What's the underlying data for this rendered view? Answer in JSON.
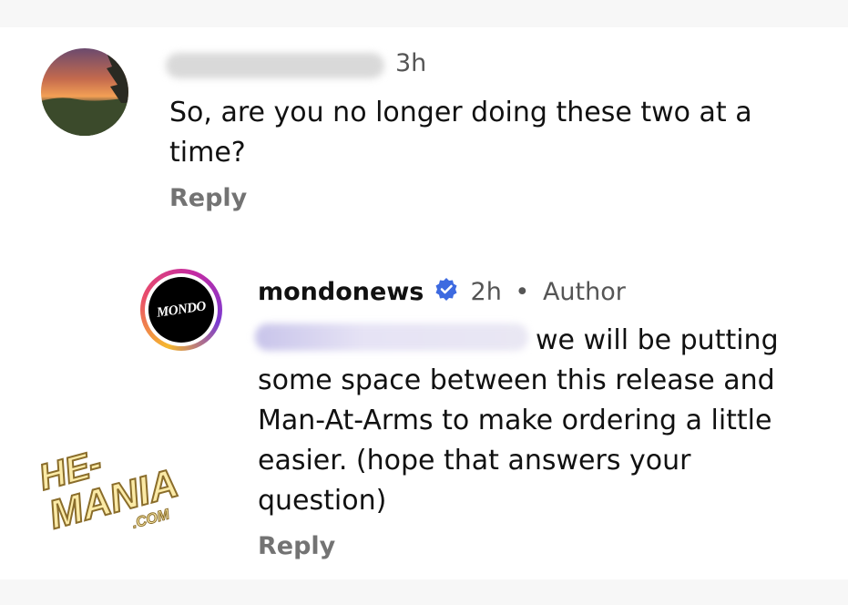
{
  "comments": [
    {
      "time": "3h",
      "text": "So, are you no longer doing these two at a time?",
      "reply_label": "Reply"
    },
    {
      "username": "mondonews",
      "avatar_text": "MONDO",
      "time": "2h",
      "separator": "•",
      "badge": "Author",
      "text": "we will be putting some space between this release and Man-At-Arms to make ordering a little easier. (hope that answers your question)",
      "reply_label": "Reply"
    }
  ],
  "watermark": {
    "line1": "HE-",
    "line2": "MANIA",
    "line3": ".COM"
  },
  "colors": {
    "verified": "#3d6ae0",
    "reply": "#737373",
    "watermark_fill": "#fbeaa6",
    "watermark_stroke": "#8a6d2b"
  }
}
